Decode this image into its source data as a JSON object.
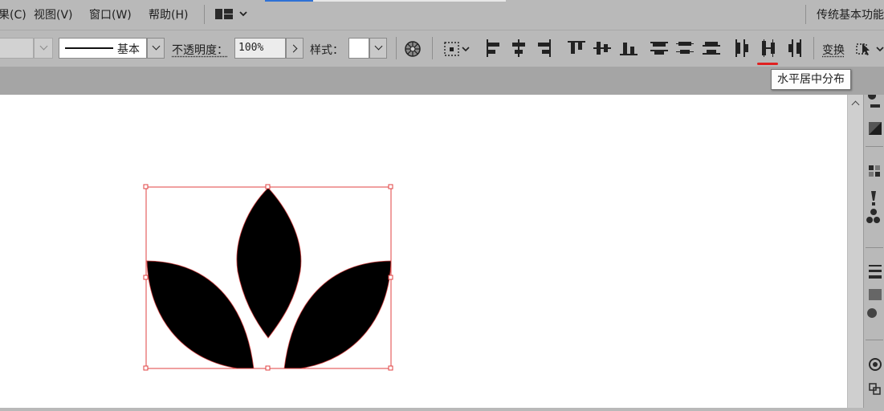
{
  "menu": {
    "items": [
      "果(C)",
      "视图(V)",
      "窗口(W)",
      "帮助(H)"
    ],
    "workspace_label": "传统基本功能"
  },
  "controlbar": {
    "stroke_style_label": "基本",
    "opacity_label": "不透明度：",
    "opacity_value": "100%",
    "style_label": "样式：",
    "transform_label": "变换"
  },
  "tooltip": {
    "text": "水平居中分布"
  },
  "icons": {
    "workspace": "workspace-layout-icon",
    "recolor": "recolor-artwork-icon",
    "align_to": "align-to-selection-icon",
    "active": "distribute-horizontal-center-icon"
  },
  "colors": {
    "accent_underline": "#e02020",
    "selection_box": "#e04040",
    "active_tab_line": "#2f72d6"
  }
}
